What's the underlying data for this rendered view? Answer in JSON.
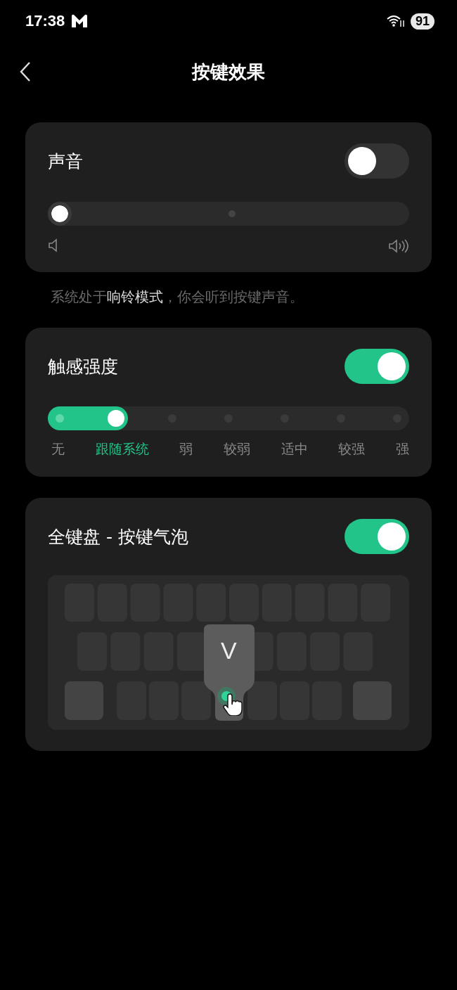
{
  "status_bar": {
    "time": "17:38",
    "battery": "91"
  },
  "header": {
    "title": "按键效果"
  },
  "sound": {
    "title": "声音",
    "on": false,
    "level": 0
  },
  "sound_note": "系统处于**响铃模式**，你会听到按键声音。",
  "haptics": {
    "title": "触感强度",
    "on": true,
    "stops": [
      {
        "label": "无",
        "selected": false
      },
      {
        "label": "跟随系统",
        "selected": true
      },
      {
        "label": "弱",
        "selected": false
      },
      {
        "label": "较弱",
        "selected": false
      },
      {
        "label": "适中",
        "selected": false
      },
      {
        "label": "较强",
        "selected": false
      },
      {
        "label": "强",
        "selected": false
      }
    ]
  },
  "bubble": {
    "title": "全键盘 - 按键气泡",
    "on": true,
    "key": "V"
  }
}
